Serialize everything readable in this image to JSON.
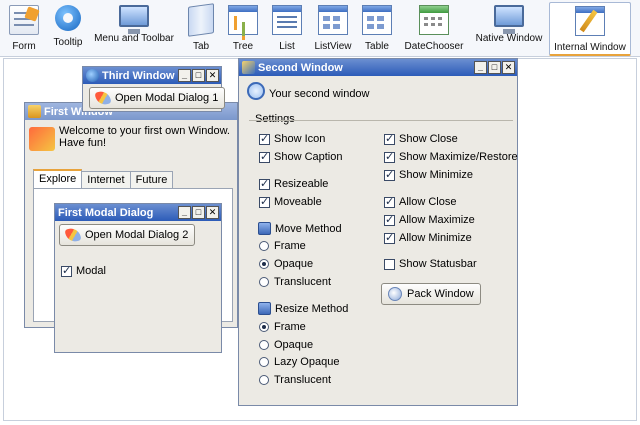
{
  "toolbar": {
    "items": [
      {
        "label": "Form",
        "icon": "form-icon"
      },
      {
        "label": "Tooltip",
        "icon": "tooltip-icon"
      },
      {
        "label": "Menu and Toolbar",
        "icon": "monitor-icon"
      },
      {
        "label": "Tab",
        "icon": "book-icon"
      },
      {
        "label": "Tree",
        "icon": "tree-icon"
      },
      {
        "label": "List",
        "icon": "list-icon"
      },
      {
        "label": "ListView",
        "icon": "listview-icon"
      },
      {
        "label": "Table",
        "icon": "table-icon"
      },
      {
        "label": "DateChooser",
        "icon": "calendar-icon"
      },
      {
        "label": "Native Window",
        "icon": "monitor-icon"
      },
      {
        "label": "Internal Window",
        "icon": "pen-icon",
        "active": true
      }
    ]
  },
  "first_window": {
    "title": "First Window",
    "welcome_line1": "Welcome to your first own Window.",
    "welcome_line2": "Have fun!",
    "tabs": [
      "Explore",
      "Internet",
      "Future"
    ],
    "active_tab": "Explore"
  },
  "third_window": {
    "title": "Third Window",
    "button": "Open Modal Dialog 1"
  },
  "modal_dialog": {
    "title": "First Modal Dialog",
    "button": "Open Modal Dialog 2",
    "modal_label": "Modal",
    "modal_checked": true
  },
  "second_window": {
    "title": "Second Window",
    "intro": "Your second window",
    "settings_label": "Settings",
    "left_checks": [
      {
        "label": "Show Icon",
        "checked": true
      },
      {
        "label": "Show Caption",
        "checked": true
      },
      {
        "label": "Resizeable",
        "checked": true
      },
      {
        "label": "Moveable",
        "checked": true
      }
    ],
    "move_method": {
      "label": "Move Method",
      "options": [
        {
          "label": "Frame",
          "selected": false
        },
        {
          "label": "Opaque",
          "selected": true
        },
        {
          "label": "Translucent",
          "selected": false
        }
      ]
    },
    "resize_method": {
      "label": "Resize Method",
      "options": [
        {
          "label": "Frame",
          "selected": true
        },
        {
          "label": "Opaque",
          "selected": false
        },
        {
          "label": "Lazy Opaque",
          "selected": false
        },
        {
          "label": "Translucent",
          "selected": false
        }
      ]
    },
    "right_checks": [
      {
        "label": "Show Close",
        "checked": true
      },
      {
        "label": "Show Maximize/Restore",
        "checked": true
      },
      {
        "label": "Show Minimize",
        "checked": true
      },
      {
        "label": "Allow Close",
        "checked": true
      },
      {
        "label": "Allow Maximize",
        "checked": true
      },
      {
        "label": "Allow Minimize",
        "checked": true
      },
      {
        "label": "Show Statusbar",
        "checked": false
      }
    ],
    "pack_button": "Pack Window"
  },
  "window_buttons": {
    "minimize": "_",
    "maximize": "□",
    "close": "✕"
  },
  "colors": {
    "titlebar_active": "#2c5bb8",
    "tab_accent": "#e8a33c"
  }
}
